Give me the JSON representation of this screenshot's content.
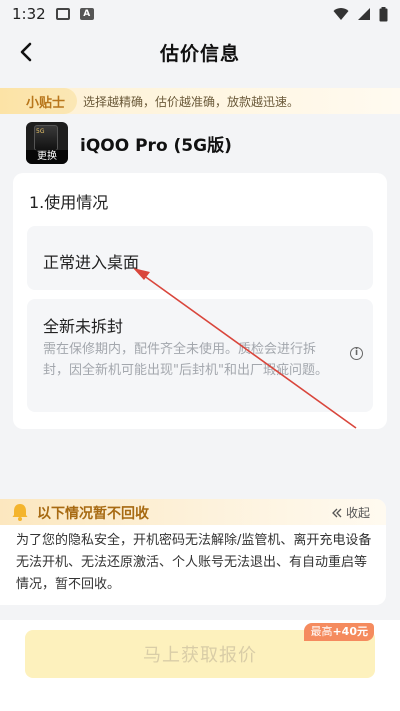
{
  "status_bar": {
    "time": "1:32"
  },
  "header": {
    "title": "估价信息"
  },
  "tips": {
    "tag": "小贴士",
    "text": "选择越精确，估价越准确，放款越迅速。"
  },
  "product": {
    "name": "iQOO Pro (5G版)",
    "change_label": "更换",
    "badge": "5G"
  },
  "usage": {
    "title": "1.使用情况",
    "options": [
      {
        "label": "正常进入桌面"
      },
      {
        "label": "全新未拆封",
        "description": "需在保修期内，配件齐全未使用。质检会进行拆封，因全新机可能出现\"后封机\"和出厂瑕疵问题。"
      }
    ]
  },
  "notice": {
    "title": "以下情况暂不回收",
    "collapse_label": "收起",
    "body": "为了您的隐私安全，开机密码无法解除/监管机、离开充电设备无法开机、无法还原激活、个人账号无法退出、有自动重启等情况，暂不回收。"
  },
  "cta": {
    "label": "马上获取报价",
    "bonus_prefix": "最高",
    "bonus_value": "+40元"
  },
  "colors": {
    "accent": "#a76a12",
    "annotation_arrow": "#d9463c",
    "cta_bg": "#fdf1bd"
  }
}
